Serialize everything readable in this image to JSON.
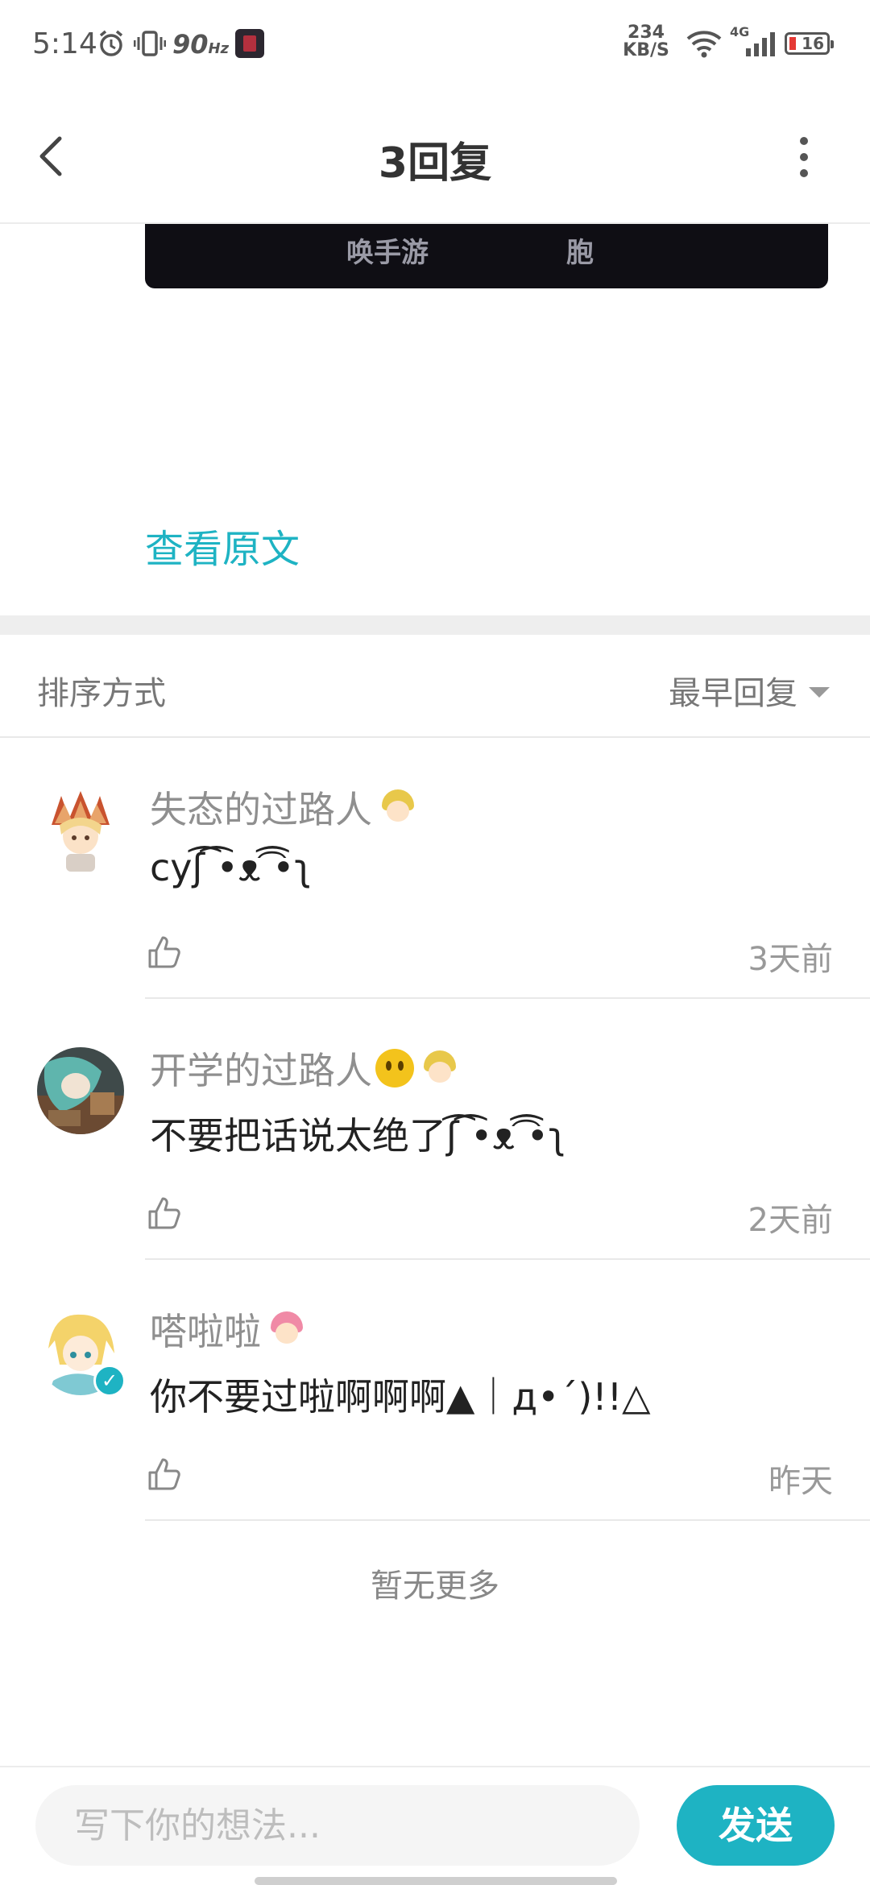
{
  "status_bar": {
    "time": "5:14",
    "refresh_rate": "90",
    "refresh_unit": "Hz",
    "net_speed_value": "234",
    "net_speed_unit": "KB/S",
    "network_type": "4G",
    "battery": "16",
    "icons": [
      "alarm-icon",
      "vibrate-icon",
      "app-icon",
      "wifi-icon",
      "cell-signal-icon",
      "battery-icon"
    ]
  },
  "header": {
    "title": "3回复",
    "back_icon": "chevron-left-icon",
    "more_icon": "more-vertical-icon"
  },
  "post": {
    "media_text_left": "唤手游",
    "media_text_right": "胞",
    "view_original": "查看原文"
  },
  "sort": {
    "label": "排序方式",
    "selected": "最早回复"
  },
  "replies": [
    {
      "nickname": "失态的过路人",
      "text": "cyʃ͡ ͡•ᴥ͡ ͡•ʅ",
      "time": "3天前",
      "verified": false
    },
    {
      "nickname": "开学的过路人",
      "text": "不要把话说太绝了ʃ͡ ͡•ᴥ͡ ͡•ʅ",
      "time": "2天前",
      "verified": false
    },
    {
      "nickname": "嗒啦啦",
      "text": "你不要过啦啊啊啊▲｜д•´)!!△",
      "time": "昨天",
      "verified": true
    }
  ],
  "footer": {
    "no_more": "暂无更多",
    "input_placeholder": "写下你的想法...",
    "send_label": "发送"
  },
  "colors": {
    "accent": "#1eb3c3",
    "divider": "#eeeeee",
    "secondary_text": "#8f8f8f"
  }
}
